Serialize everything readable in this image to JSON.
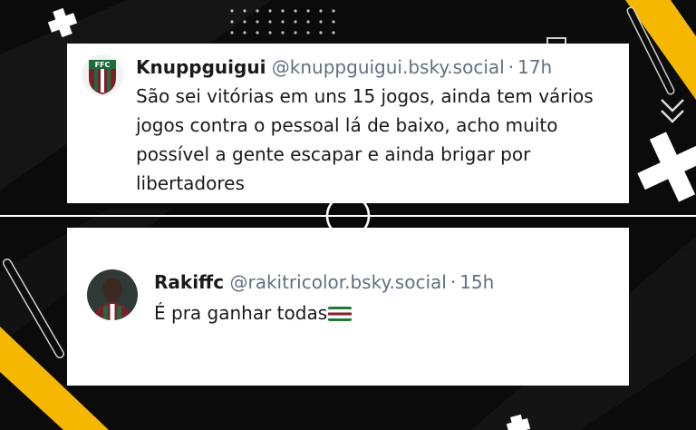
{
  "posts": [
    {
      "display_name": "Knuppguigui",
      "handle": "@knuppguigui.bsky.social",
      "separator": "·",
      "time": "17h",
      "text": "São sei vitórias em uns 15 jogos, ainda tem vários jogos contra o pessoal lá de baixo, acho muito possível a gente escapar e ainda brigar por libertadores",
      "avatar_icon": "fluminense-crest-avatar"
    },
    {
      "display_name": "Rakiffc",
      "handle": "@rakitricolor.bsky.social",
      "separator": "·",
      "time": "15h",
      "text": "É pra ganhar todas",
      "emoji": "fluminense-flag-emoji",
      "avatar_icon": "player-photo-avatar"
    }
  ],
  "colors": {
    "background": "#0b0b0b",
    "accent_yellow": "#f5b700",
    "card": "#ffffff",
    "handle_gray": "#61707f"
  }
}
